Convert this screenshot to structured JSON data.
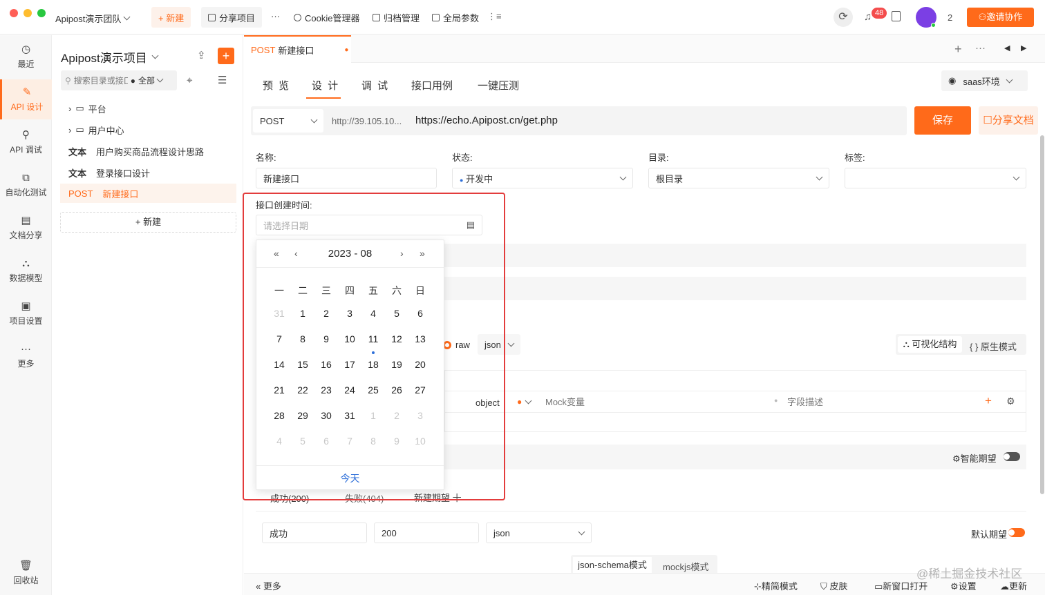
{
  "titlebar": {
    "team": "Apipost演示团队",
    "new_label": "+ 新建",
    "share_project": "分享项目",
    "more": "···",
    "cookie": "Cookie管理器",
    "archive": "归档管理",
    "global_params": "全局参数",
    "notif_count": "48",
    "user_count": "2",
    "invite": "邀请协作"
  },
  "sidebar": {
    "items": [
      {
        "label": "最近",
        "icon": "clock-icon"
      },
      {
        "label": "API 设计",
        "icon": "edit-icon"
      },
      {
        "label": "API 调试",
        "icon": "link-icon"
      },
      {
        "label": "自动化测试",
        "icon": "flow-icon"
      },
      {
        "label": "文档分享",
        "icon": "doc-icon"
      },
      {
        "label": "数据模型",
        "icon": "model-icon"
      },
      {
        "label": "项目设置",
        "icon": "settings-icon"
      },
      {
        "label": "更多",
        "icon": "more-icon"
      }
    ],
    "recycle": "回收站"
  },
  "tree": {
    "project": "Apipost演示项目",
    "search_placeholder": "搜索目录或接口",
    "filter": "全部",
    "rows": [
      {
        "prefix": "",
        "label": "平台"
      },
      {
        "prefix": "",
        "label": "用户中心"
      },
      {
        "prefix": "文本",
        "label": "用户购买商品流程设计思路"
      },
      {
        "prefix": "文本",
        "label": "登录接口设计"
      },
      {
        "prefix": "POST",
        "label": "新建接口"
      }
    ],
    "new_btn": "+ 新建"
  },
  "main": {
    "tab": {
      "method": "POST",
      "name": "新建接口"
    },
    "subtabs": [
      "预 览",
      "设 计",
      "调 试",
      "接口用例",
      "一键压测"
    ],
    "env": "saas环境",
    "method": "POST",
    "host": "http://39.105.10...",
    "url": "https://echo.Apipost.cn/get.php",
    "save": "保存",
    "share_doc": "分享文档",
    "labels": {
      "name": "名称:",
      "status": "状态:",
      "dir": "目录:",
      "tag": "标签:"
    },
    "name_value": "新建接口",
    "status_value": "开发中",
    "dir_value": "根目录",
    "created_label": "接口创建时间:",
    "date_placeholder": "请选择日期",
    "raw": "raw",
    "json": "json",
    "visual": "可视化结构",
    "native": "原生模式",
    "object": "object",
    "mock_placeholder": "Mock变量",
    "field_desc": "字段描述",
    "smart": "智能期望",
    "tabs_exp": [
      "成功(200)",
      "失败(404)",
      "新建期望 十"
    ],
    "exp_name": "成功",
    "exp_code": "200",
    "exp_type": "json",
    "default_exp": "默认期望",
    "schema_tabs": [
      "json-schema模式",
      "mockjs模式"
    ]
  },
  "calendar": {
    "title": "2023 - 08",
    "weekdays": [
      "一",
      "二",
      "三",
      "四",
      "五",
      "六",
      "日"
    ],
    "rows": [
      [
        "31",
        "1",
        "2",
        "3",
        "4",
        "5",
        "6"
      ],
      [
        "7",
        "8",
        "9",
        "10",
        "11",
        "12",
        "13"
      ],
      [
        "14",
        "15",
        "16",
        "17",
        "18",
        "19",
        "20"
      ],
      [
        "21",
        "22",
        "23",
        "24",
        "25",
        "26",
        "27"
      ],
      [
        "28",
        "29",
        "30",
        "31",
        "1",
        "2",
        "3"
      ],
      [
        "4",
        "5",
        "6",
        "7",
        "8",
        "9",
        "10"
      ]
    ],
    "today": "今天"
  },
  "bottom": {
    "more": "更多",
    "simple": "精简模式",
    "skin": "皮肤",
    "new_window": "新窗口打开",
    "settings": "设置",
    "update": "更新",
    "watermark": "@稀土掘金技术社区"
  },
  "colors": {
    "accent": "#ff6a1a",
    "link": "#2e6fd9",
    "highlight": "#e33c3c"
  }
}
